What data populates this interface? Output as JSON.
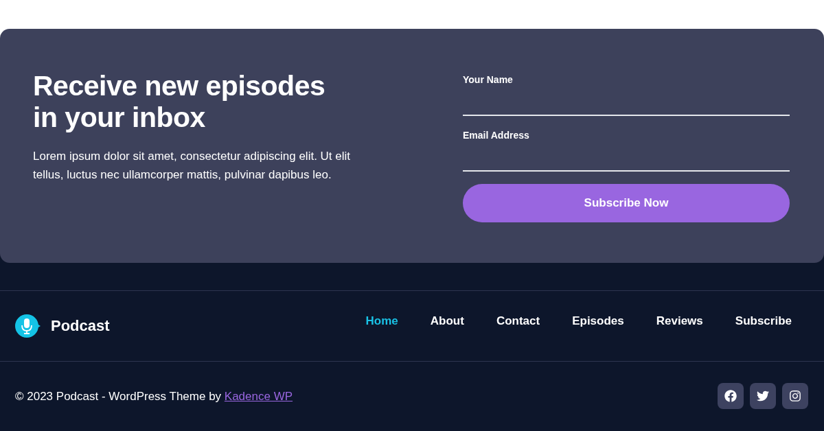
{
  "signup": {
    "heading": "Receive new episodes in your inbox",
    "description": "Lorem ipsum dolor sit amet, consectetur adipiscing elit. Ut elit tellus, luctus nec ullamcorper mattis, pulvinar dapibus leo.",
    "fields": [
      {
        "label": "Your Name"
      },
      {
        "label": "Email Address"
      }
    ],
    "button": "Subscribe Now"
  },
  "footer": {
    "logo": "Podcast",
    "nav": [
      {
        "label": "Home",
        "selected": true
      },
      {
        "label": "About",
        "selected": false
      },
      {
        "label": "Contact",
        "selected": false
      },
      {
        "label": "Episodes",
        "selected": false
      },
      {
        "label": "Reviews",
        "selected": false
      },
      {
        "label": "Subscribe",
        "selected": false
      }
    ],
    "copyright": "© 2023 Podcast - WordPress Theme by",
    "credit_link": "Kadence WP",
    "social": [
      {
        "kind": "facebook"
      },
      {
        "kind": "twitter"
      },
      {
        "kind": "instagram"
      }
    ]
  }
}
